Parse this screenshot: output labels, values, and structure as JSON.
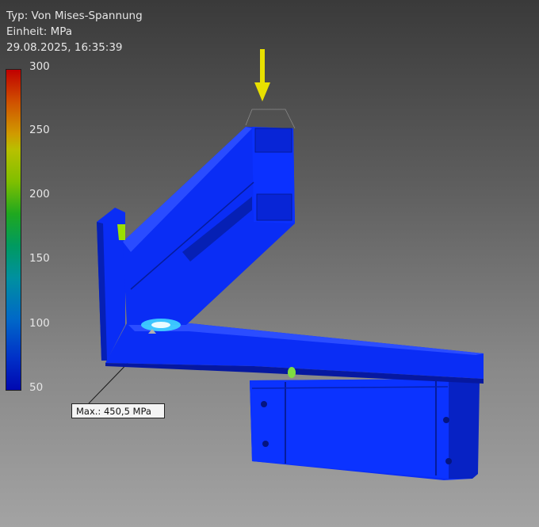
{
  "info": {
    "type_label": "Typ: Von Mises-Spannung",
    "unit_label": "Einheit: MPa",
    "timestamp": "29.08.2025, 16:35:39"
  },
  "legend": {
    "ticks": [
      "300",
      "250",
      "200",
      "150",
      "100",
      "50"
    ],
    "max_color": "#c00000",
    "min_color": "#0008b0"
  },
  "probe": {
    "label": "Max.: 450,5 MPa"
  },
  "colors": {
    "part_blue": "#0a2df5",
    "part_dark": "#0718a8",
    "load_arrow": "#e8e000",
    "hotspot": "#9be000"
  },
  "icons": {
    "load": "load-arrow-icon"
  }
}
